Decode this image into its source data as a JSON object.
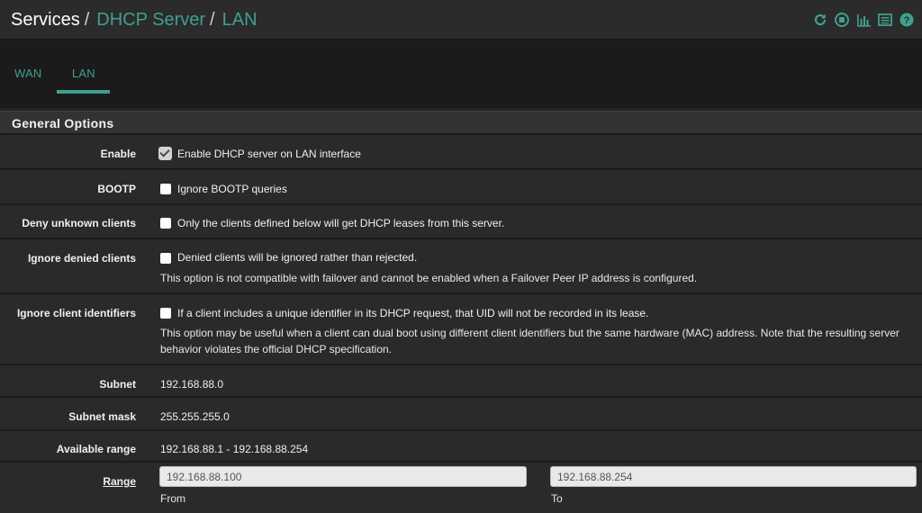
{
  "breadcrumb": {
    "services": "Services",
    "dhcp_server": "DHCP Server",
    "lan": "LAN",
    "separator": "/"
  },
  "toolbar_icons": [
    "reload-icon",
    "stop-icon",
    "status-chart-icon",
    "log-icon",
    "help-icon"
  ],
  "tabs": [
    {
      "label": "WAN",
      "active": false
    },
    {
      "label": "LAN",
      "active": true
    }
  ],
  "colors": {
    "accent": "#3fa08f",
    "background": "#1c1c1c",
    "row": "#2a2a2a"
  },
  "section": {
    "title": "General Options"
  },
  "options": {
    "enable": {
      "label": "Enable",
      "checked": true,
      "text": "Enable DHCP server on LAN interface"
    },
    "bootp": {
      "label": "BOOTP",
      "checked": false,
      "text": "Ignore BOOTP queries"
    },
    "deny_unknown": {
      "label": "Deny unknown clients",
      "checked": false,
      "text": "Only the clients defined below will get DHCP leases from this server."
    },
    "ignore_denied": {
      "label": "Ignore denied clients",
      "checked": false,
      "text": "Denied clients will be ignored rather than rejected.",
      "help": "This option is not compatible with failover and cannot be enabled when a Failover Peer IP address is configured."
    },
    "ignore_client_ids": {
      "label": "Ignore client identifiers",
      "checked": false,
      "text": "If a client includes a unique identifier in its DHCP request, that UID will not be recorded in its lease.",
      "help": "This option may be useful when a client can dual boot using different client identifiers but the same hardware (MAC) address. Note that the resulting server behavior violates the official DHCP specification."
    }
  },
  "network": {
    "subnet_label": "Subnet",
    "subnet": "192.168.88.0",
    "mask_label": "Subnet mask",
    "mask": "255.255.255.0",
    "available_label": "Available range",
    "available": "192.168.88.1 - 192.168.88.254"
  },
  "range": {
    "label": "Range",
    "from_value": "192.168.88.100",
    "from_label": "From",
    "to_value": "192.168.88.254",
    "to_label": "To"
  }
}
